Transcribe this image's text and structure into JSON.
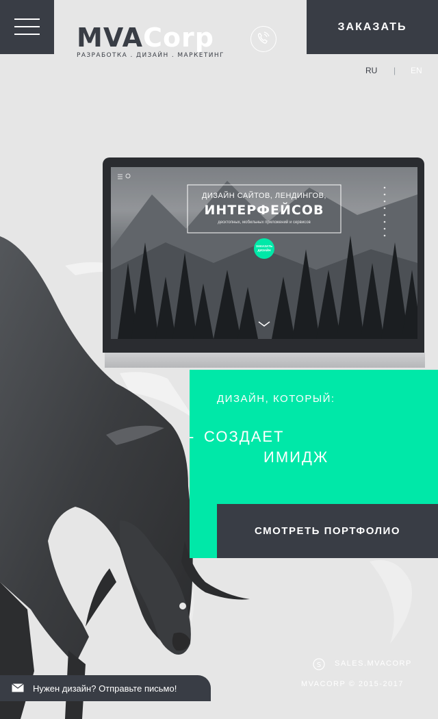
{
  "header": {
    "logo_main": "MVA",
    "logo_accent": "Corp",
    "logo_tagline": "РАЗРАБОТКА . ДИЗАЙН . МАРКЕТИНГ",
    "order_label": "ЗАКАЗАТЬ"
  },
  "lang": {
    "ru": "RU",
    "separator": "|",
    "en": "EN"
  },
  "mockup": {
    "line1": "ДИЗАЙН САЙТОВ, ЛЕНДИНГОВ,",
    "line2": "ИНТЕРФЕЙСОВ",
    "line3": "десктопных, мобильных приложений и сервисов",
    "order_line1": "ЗАКАЗАТЬ",
    "order_line2": "ДИЗАЙН"
  },
  "hero": {
    "tagline": "ДИЗАЙН, КОТОРЫЙ:",
    "dash": "-",
    "line1": "СОЗДАЕТ",
    "line2": "ИМИДЖ",
    "portfolio_label": "СМОТРЕТЬ ПОРТФОЛИО"
  },
  "footer": {
    "skype": "SALES.MVACORP",
    "copyright": "MVACORP © 2015-2017",
    "mail_cta": "Нужен дизайн? Отправьте письмо!"
  },
  "colors": {
    "dark": "#393d45",
    "accent": "#00e8a8",
    "bg": "#e6e6e6"
  },
  "icons": [
    "hamburger-icon",
    "phone-icon",
    "skype-icon",
    "mail-icon",
    "chevron-down-icon"
  ]
}
